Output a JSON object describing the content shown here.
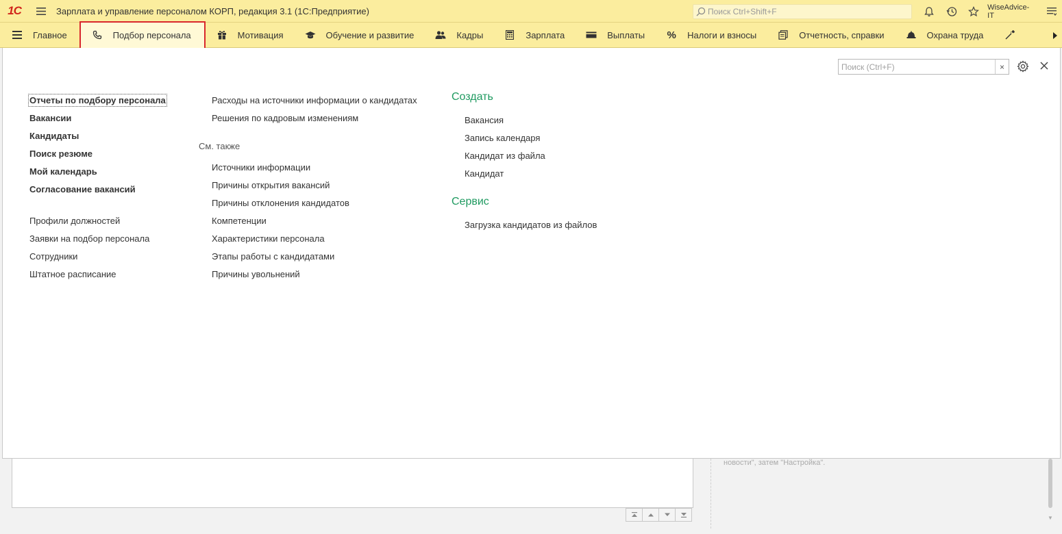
{
  "titlebar": {
    "logo": "1С",
    "app_title": "Зарплата и управление персоналом КОРП, редакция 3.1  (1С:Предприятие)",
    "search_placeholder": "Поиск Ctrl+Shift+F",
    "username": "WiseAdvice-IT"
  },
  "sections": [
    {
      "label": "Главное",
      "icon": "hamburger-icon"
    },
    {
      "label": "Подбор персонала",
      "icon": "phone-icon",
      "active": true
    },
    {
      "label": "Мотивация",
      "icon": "gift-icon"
    },
    {
      "label": "Обучение и развитие",
      "icon": "graduation-cap-icon"
    },
    {
      "label": "Кадры",
      "icon": "people-icon"
    },
    {
      "label": "Зарплата",
      "icon": "calculator-icon"
    },
    {
      "label": "Выплаты",
      "icon": "wallet-icon"
    },
    {
      "label": "Налоги и взносы",
      "icon": "percent-icon"
    },
    {
      "label": "Отчетность, справки",
      "icon": "documents-icon"
    },
    {
      "label": "Охрана труда",
      "icon": "helmet-icon"
    },
    {
      "label": "",
      "icon": "wrench-icon"
    }
  ],
  "panel": {
    "search_placeholder": "Поиск (Ctrl+F)",
    "clear_label": "×"
  },
  "col1": {
    "bold_links": [
      "Отчеты по подбору персонала",
      "Вакансии",
      "Кандидаты",
      "Поиск резюме",
      "Мой календарь",
      "Согласование вакансий"
    ],
    "links": [
      "Профили должностей",
      "Заявки на подбор персонала",
      "Сотрудники",
      "Штатное расписание"
    ]
  },
  "col2": {
    "links": [
      "Расходы на источники информации о кандидатах",
      "Решения по кадровым изменениям"
    ],
    "see_also_header": "См. также",
    "see_also_links": [
      "Источники информации",
      "Причины открытия вакансий",
      "Причины отклонения кандидатов",
      "Компетенции",
      "Характеристики персонала",
      "Этапы работы с кандидатами",
      "Причины увольнений"
    ]
  },
  "col3": {
    "create_header": "Создать",
    "create_links": [
      "Вакансия",
      "Запись календаря",
      "Кандидат из файла",
      "Кандидат"
    ],
    "service_header": "Сервис",
    "service_links": [
      "Загрузка кандидатов из файлов"
    ]
  },
  "bottom": {
    "news_text": "новости\", затем \"Настройка\"."
  },
  "colors": {
    "bar_bg": "#fbed9e",
    "accent_green": "#1f9a60",
    "highlight_red": "#d8262c"
  }
}
